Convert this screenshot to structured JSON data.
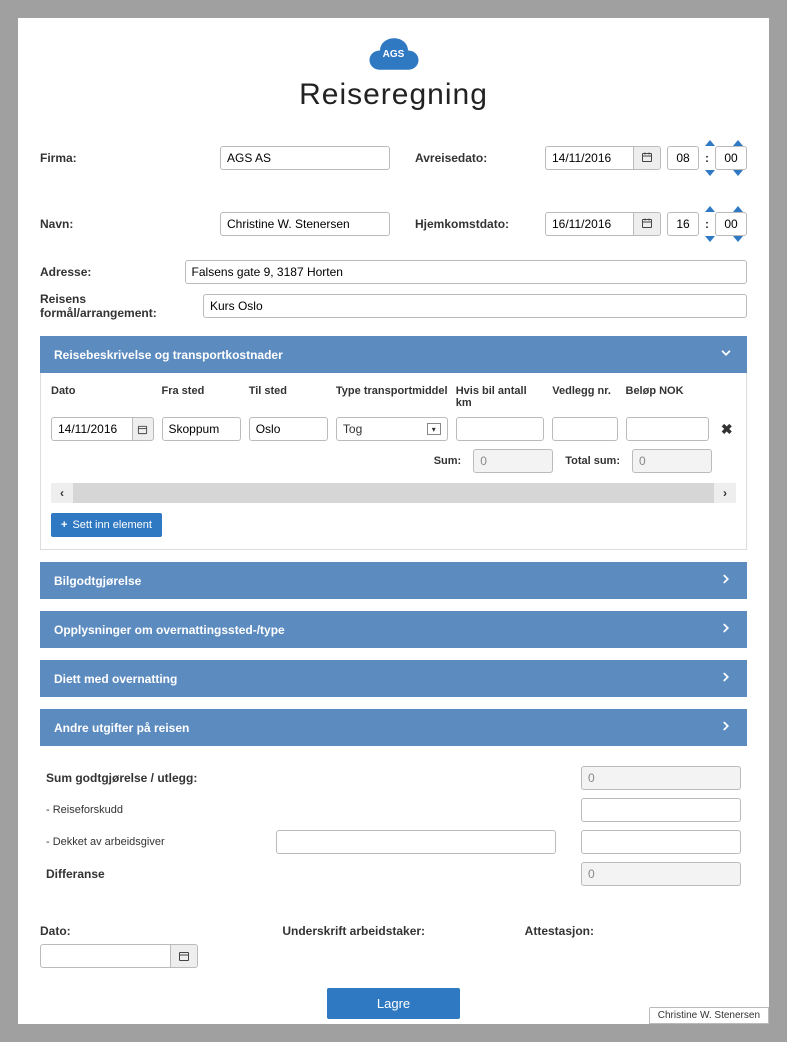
{
  "header": {
    "cloud_label": "AGS",
    "title": "Reiseregning"
  },
  "labels": {
    "firma": "Firma:",
    "navn": "Navn:",
    "adresse": "Adresse:",
    "formaal": "Reisens formål/arrangement:",
    "avreise": "Avreisedato:",
    "hjemkomst": "Hjemkomstdato:",
    "colon": ":"
  },
  "fields": {
    "firma": "AGS AS",
    "navn": "Christine W. Stenersen",
    "adresse": "Falsens gate 9, 3187 Horten",
    "formaal": "Kurs Oslo",
    "avreise_date": "14/11/2016",
    "avreise_hh": "08",
    "avreise_mm": "00",
    "hjemkomst_date": "16/11/2016",
    "hjemkomst_hh": "16",
    "hjemkomst_mm": "00"
  },
  "sections": {
    "transport": "Reisebeskrivelse og transportkostnader",
    "bil": "Bilgodtgjørelse",
    "overnatting": "Opplysninger om overnattingssted-/type",
    "diett": "Diett med overnatting",
    "andre": "Andre utgifter på reisen"
  },
  "transport": {
    "headers": {
      "dato": "Dato",
      "fra": "Fra sted",
      "til": "Til sted",
      "type": "Type transportmiddel",
      "km": "Hvis bil antall km",
      "vedlegg": "Vedlegg nr.",
      "belop": "Beløp NOK"
    },
    "rows": [
      {
        "dato": "14/11/2016",
        "fra": "Skoppum",
        "til": "Oslo",
        "type": "Tog",
        "km": "",
        "vedlegg": "",
        "belop": ""
      }
    ],
    "sum_label": "Sum:",
    "sum_value": "0",
    "total_label": "Total sum:",
    "total_value": "0",
    "insert_label": "Sett inn element"
  },
  "summary": {
    "sum_label": "Sum godtgjørelse / utlegg:",
    "sum_value": "0",
    "reiseforskudd_label": "- Reiseforskudd",
    "dekket_label": "- Dekket av arbeidsgiver",
    "differanse_label": "Differanse",
    "differanse_value": "0"
  },
  "signatures": {
    "dato_label": "Dato:",
    "arbeidstaker_label": "Underskrift arbeidstaker:",
    "attestasjon_label": "Attestasjon:"
  },
  "save_label": "Lagre",
  "user_pill": "Christine W. Stenersen"
}
